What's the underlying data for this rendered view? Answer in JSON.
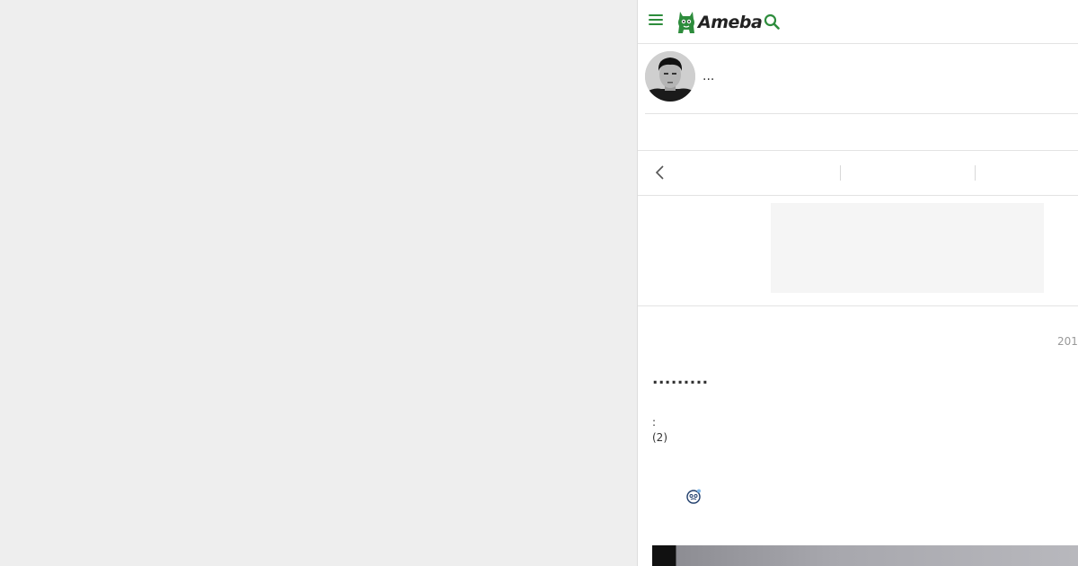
{
  "header": {
    "logo_text": "Ameba",
    "brand_color": "#2d8c3c",
    "menu_icon": "hamburger-menu-icon",
    "search_icon": "search-icon"
  },
  "profile": {
    "blog_title": "..."
  },
  "entry": {
    "date": "201",
    "title": ".........",
    "meta_line1": ":",
    "meta_line2": "(2)",
    "emoji_icon": "emoji-icon"
  }
}
